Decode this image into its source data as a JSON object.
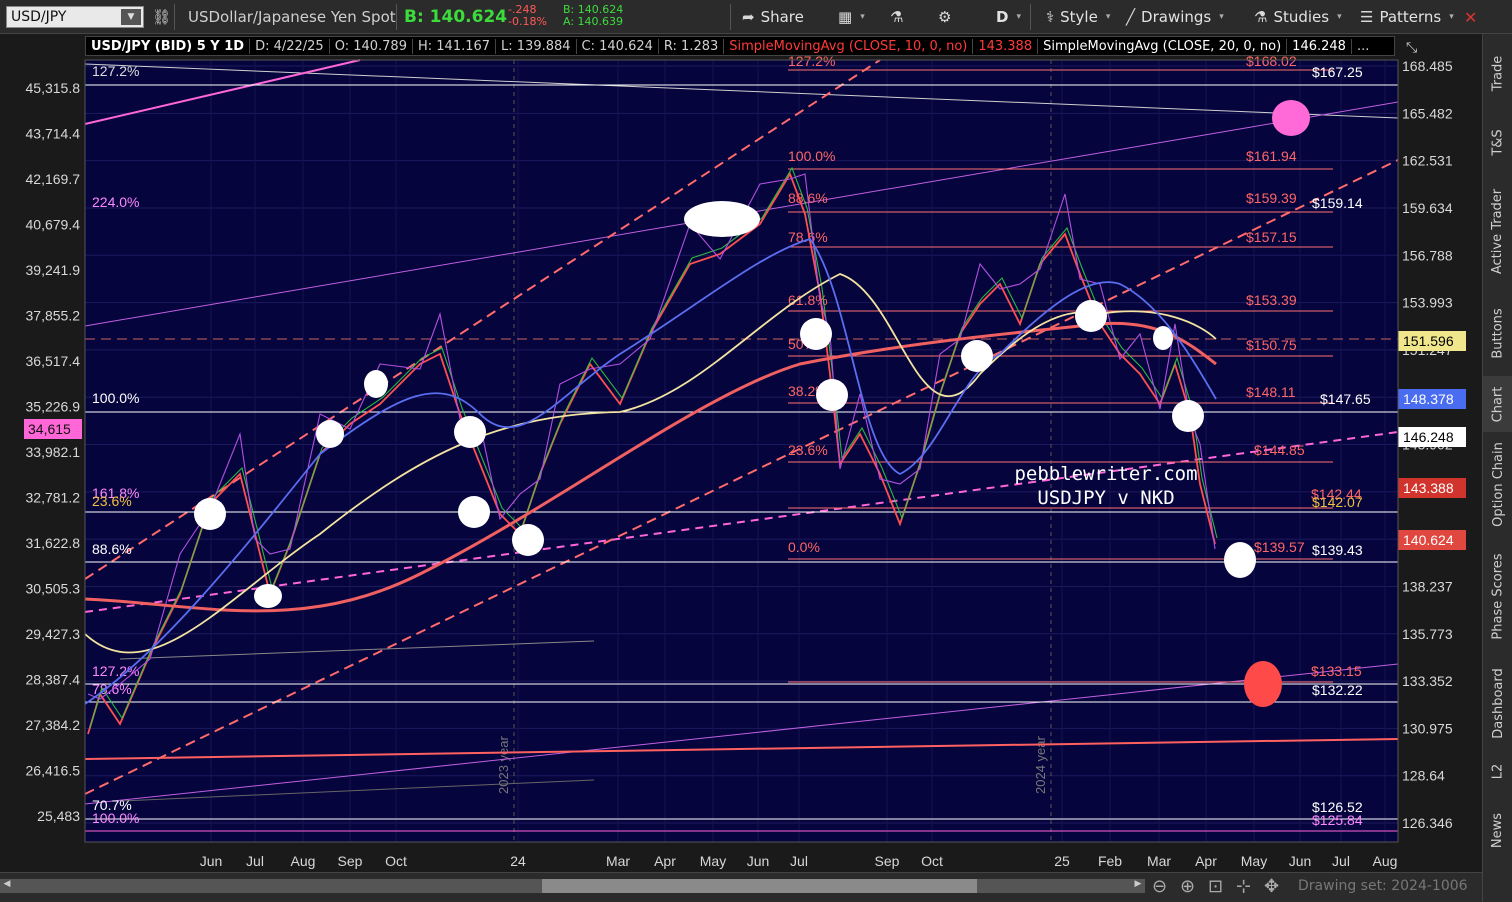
{
  "toolbar": {
    "symbol": "USD/JPY",
    "description": "USDollar/Japanese Yen Spot",
    "bid": "B: 140.624",
    "change": "-.248",
    "change_pct": "-0.18%",
    "bid_small": "B: 140.624",
    "ask_small": "A: 140.639",
    "share": "Share",
    "period": "D",
    "style": "Style",
    "drawings": "Drawings",
    "studies": "Studies",
    "patterns": "Patterns"
  },
  "info": {
    "title": "USD/JPY (BID) 5 Y 1D",
    "date": "D: 4/22/25",
    "open": "O: 140.789",
    "high": "H: 141.167",
    "low": "L: 139.884",
    "close": "C: 140.624",
    "range": "R: 1.283",
    "sma10": "SimpleMovingAvg (CLOSE, 10, 0, no)",
    "sma10_val": "143.388",
    "sma20": "SimpleMovingAvg (CLOSE, 20, 0, no)",
    "sma20_val": "146.248",
    "more": "..."
  },
  "side_tabs": [
    "Trade",
    "T&S",
    "Active Trader",
    "Buttons",
    "Chart",
    "Option Chain",
    "Phase Scores",
    "Dashboard",
    "L2",
    "News"
  ],
  "chart_data": {
    "type": "line",
    "right_axis": [
      "168.485",
      "165.482",
      "162.531",
      "159.634",
      "156.788",
      "153.993",
      "151.247",
      "148.551",
      "145.902",
      "143.300",
      "140.624",
      "138.237",
      "135.773",
      "133.352",
      "130.975",
      "128.64",
      "126.346"
    ],
    "left_axis": [
      "45,315.8",
      "43,714.4",
      "42,169.7",
      "40,679.4",
      "39,241.9",
      "37,855.2",
      "36,517.4",
      "35,226.9",
      "33,982.1",
      "32,781.2",
      "31,622.8",
      "30,505.3",
      "29,427.3",
      "28,387.4",
      "27,384.2",
      "26,416.5",
      "25,483"
    ],
    "x_labels": [
      "Jun",
      "Jul",
      "Aug",
      "Sep",
      "Oct",
      "24",
      "Mar",
      "Apr",
      "May",
      "Jun",
      "Jul",
      "Sep",
      "Oct",
      "25",
      "Feb",
      "Mar",
      "Apr",
      "May",
      "Jun",
      "Jul",
      "Aug"
    ],
    "year_marks": [
      "2023 year",
      "2024 year"
    ],
    "price_tags": [
      {
        "label": "151.596",
        "color": "#f0e68c",
        "text": "#000"
      },
      {
        "label": "148.378",
        "color": "#4a6cf0",
        "text": "#fff"
      },
      {
        "label": "146.248",
        "color": "#ffffff",
        "text": "#000"
      },
      {
        "label": "143.388",
        "color": "#d0342c",
        "text": "#fff"
      },
      {
        "label": "140.624",
        "color": "#e0473f",
        "text": "#fff"
      }
    ],
    "left_tag": {
      "label": "34,615",
      "color": "#ff66d8"
    },
    "fib_left": [
      "127.2%",
      "224.0%",
      "100.0%",
      "161.8%",
      "23.6%",
      "88.6%",
      "127.2%",
      "78.6%",
      "70.7%",
      "100.0%"
    ],
    "fib_mid": [
      "127.2%",
      "100.0%",
      "88.6%",
      "78.6%",
      "61.8%",
      "50%",
      "38.2%",
      "23.6%",
      "0.0%"
    ],
    "price_labels_red": [
      "$168.02",
      "$161.94",
      "$159.39",
      "$157.15",
      "$153.39",
      "$150.75",
      "$148.11",
      "$144.85",
      "$142.44",
      "$139.57",
      "$133.15"
    ],
    "price_labels_white": [
      "$167.25",
      "$159.14",
      "$147.65",
      "$142.07",
      "$139.43",
      "$132.22",
      "$126.52",
      "$125.84"
    ],
    "watermark": [
      "pebblewriter.com",
      "USDJPY v NKD"
    ]
  },
  "bottom": {
    "drawing_set": "Drawing set: 2024-1006"
  }
}
